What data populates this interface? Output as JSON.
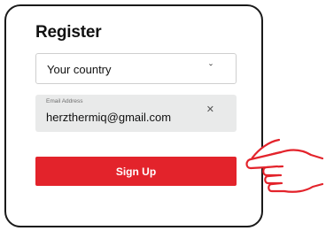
{
  "form": {
    "title": "Register",
    "country_select": {
      "value": "Your country",
      "icon": "chevron-down-icon"
    },
    "email": {
      "label": "Email Address",
      "value": "herzthermiq@gmail.com",
      "clear_icon": "close-icon"
    },
    "submit_label": "Sign Up"
  },
  "pointer_icon": "pointing-hand-icon",
  "colors": {
    "accent": "#e3232b",
    "field_background": "#e9eaea",
    "border": "#1a1a1a"
  }
}
